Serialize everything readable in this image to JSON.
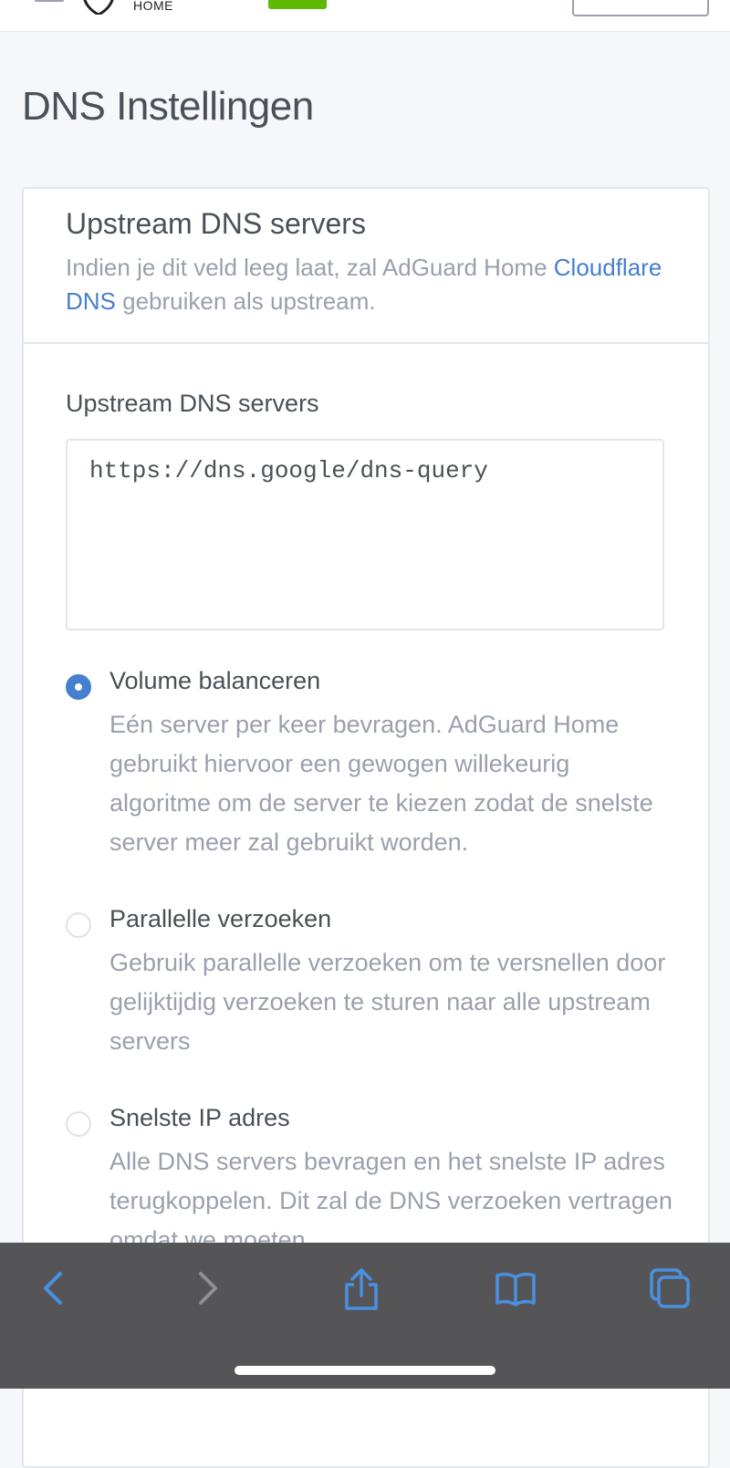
{
  "header": {
    "logo_text": "HOME"
  },
  "page": {
    "title": "DNS Instellingen"
  },
  "card": {
    "title": "Upstream DNS servers",
    "desc_prefix": "Indien je dit veld leeg laat, zal AdGuard Home ",
    "desc_link": "Cloudflare DNS",
    "desc_suffix": " gebruiken als upstream."
  },
  "upstream_field": {
    "label": "Upstream DNS servers",
    "value": "https://dns.google/dns-query"
  },
  "mode_options": [
    {
      "label": "Volume balanceren",
      "description": "Eén server per keer bevragen. AdGuard Home gebruikt hiervoor een gewogen willekeurig algoritme om de server te kiezen zodat de snelste server meer zal gebruikt worden.",
      "checked": true
    },
    {
      "label": "Parallelle verzoeken",
      "description": "Gebruik parallelle verzoeken om te versnellen door gelijktijdig verzoeken te sturen naar alle upstream servers",
      "checked": false
    },
    {
      "label": "Snelste IP adres",
      "description": "Alle DNS servers bevragen en het snelste IP adres terugkoppelen. Dit zal de DNS verzoeken vertragen omdat we moeten",
      "checked": false
    }
  ],
  "toolbar": {
    "icons": [
      "back-icon",
      "forward-icon",
      "share-icon",
      "bookmarks-icon",
      "tabs-icon"
    ],
    "accent": "#4a90e2",
    "disabled": "#8e8e93"
  },
  "colors": {
    "primary": "#467fcf",
    "muted": "#9aa0ac",
    "text": "#495057",
    "background": "#f5f7fb"
  }
}
